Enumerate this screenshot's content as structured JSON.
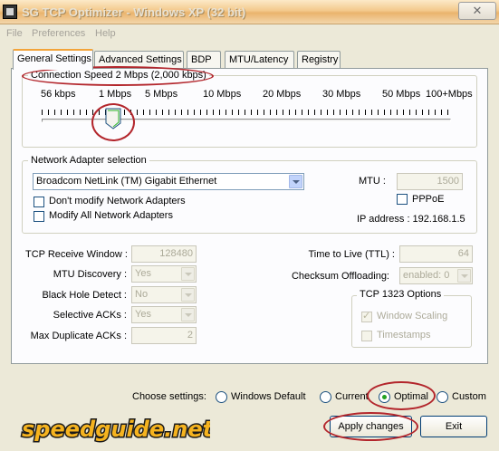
{
  "window": {
    "title": "SG TCP Optimizer - Windows XP (32 bit)",
    "close_glyph": "✕"
  },
  "menu": [
    "File",
    "Preferences",
    "Help"
  ],
  "tabs": [
    {
      "label": "General Settings",
      "active": true
    },
    {
      "label": "Advanced Settings",
      "active": false
    },
    {
      "label": "BDP",
      "active": false
    },
    {
      "label": "MTU/Latency",
      "active": false
    },
    {
      "label": "Registry",
      "active": false
    }
  ],
  "connection_speed": {
    "label": "Connection Speed  2 Mbps (2,000 kbps)",
    "ticks": [
      "56 kbps",
      "1 Mbps",
      "5 Mbps",
      "10 Mbps",
      "20 Mbps",
      "30 Mbps",
      "50 Mbps",
      "100+Mbps"
    ],
    "selected": "2 Mbps"
  },
  "network_adapter": {
    "group_label": "Network Adapter selection",
    "selected_adapter": "Broadcom NetLink (TM) Gigabit Ethernet",
    "dont_modify_label": "Don't modify Network Adapters",
    "modify_all_label": "Modify All Network Adapters",
    "mtu_label": "MTU :",
    "mtu_value": "1500",
    "pppoe_label": "PPPoE",
    "ip_address": "IP address : 192.168.1.5"
  },
  "tcp": {
    "receive_window_label": "TCP Receive Window :",
    "receive_window_value": "128480",
    "mtu_discovery_label": "MTU Discovery :",
    "mtu_discovery_value": "Yes",
    "black_hole_label": "Black Hole Detect :",
    "black_hole_value": "No",
    "selective_acks_label": "Selective ACKs :",
    "selective_acks_value": "Yes",
    "max_dup_acks_label": "Max Duplicate ACKs :",
    "max_dup_acks_value": "2",
    "ttl_label": "Time to Live (TTL) :",
    "ttl_value": "64",
    "checksum_label": "Checksum Offloading:",
    "checksum_value": "enabled: 0"
  },
  "tcp1323": {
    "group_label": "TCP 1323 Options",
    "window_scaling_label": "Window Scaling",
    "timestamps_label": "Timestamps"
  },
  "choose": {
    "label": "Choose settings:",
    "options": [
      "Windows Default",
      "Current",
      "Optimal",
      "Custom"
    ],
    "selected": "Optimal"
  },
  "buttons": {
    "apply": "Apply changes",
    "exit": "Exit"
  },
  "logo": {
    "text": "speedguide.net"
  }
}
